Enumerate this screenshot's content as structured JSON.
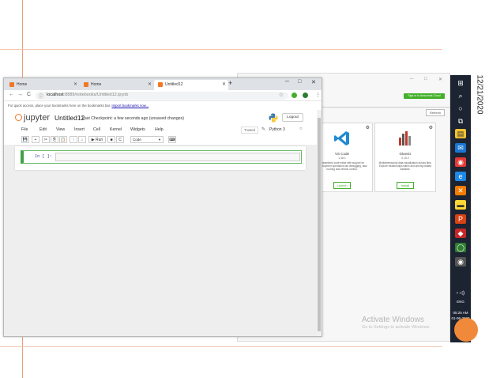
{
  "colors": {
    "accent": "#f37726",
    "anaconda_green": "#43b02a",
    "taskbar": "#1c2331",
    "cell_border": "#42a047"
  },
  "browser": {
    "tabs": [
      {
        "label": "Home",
        "icon": "jupyter-favicon"
      },
      {
        "label": "Home",
        "icon": "jupyter-favicon"
      },
      {
        "label": "Untitled12",
        "icon": "jupyter-favicon"
      }
    ],
    "new_tab": "+",
    "controls": {
      "minimize": "─",
      "maximize": "□",
      "close": "✕"
    },
    "nav": {
      "back": "←",
      "forward": "→",
      "reload": "C"
    },
    "url_host": "localhost",
    "url_path": ":8889/notebooks/Untitled12.ipynb",
    "bookmarks_text": "For quick access, place your bookmarks here on the bookmarks bar.",
    "bookmarks_link": "Import bookmarks now..."
  },
  "jupyter": {
    "logo_text": "jupyter",
    "notebook_title": "Untitled12",
    "checkpoint": "Last Checkpoint: a few seconds ago",
    "status": "(unsaved changes)",
    "logout": "Logout",
    "menu": [
      "File",
      "Edit",
      "View",
      "Insert",
      "Cell",
      "Kernel",
      "Widgets",
      "Help"
    ],
    "trusted": "Trusted",
    "kernel_name": "Python 3",
    "toolbar": {
      "save": "💾",
      "add": "+",
      "cut": "✂",
      "copy": "⎘",
      "paste": "📋",
      "up": "↑",
      "down": "↓",
      "run": "▶ Run",
      "stop": "■",
      "restart": "C",
      "fastforward": "⏭",
      "keyboard": "⌨"
    },
    "cell_type": "Code",
    "cell_prompt": "In [ ]:"
  },
  "background_app": {
    "window_controls": [
      "─",
      "□",
      "✕"
    ],
    "signin": "Sign in to Anaconda Cloud",
    "refresh": "Refresh",
    "cards": [
      {
        "name": "VS Code",
        "version": "1.38.1",
        "desc": "Streamlined code editor with support for development operations like debugging, task running and version control.",
        "button": "Launch",
        "icon": "vscode-icon"
      },
      {
        "name": "Glueviz",
        "version": "0.15.2",
        "desc": "Multidimensional data visualization across files. Explore relationships within and among related datasets.",
        "button": "Install",
        "icon": "glueviz-icon"
      }
    ],
    "activate_title": "Activate Windows",
    "activate_sub": "Go to Settings to activate Windows."
  },
  "taskbar": {
    "date_vertical": "12/21/2020",
    "lang": "ENG",
    "time": "05:25 AM",
    "date": "01-06-2020"
  }
}
